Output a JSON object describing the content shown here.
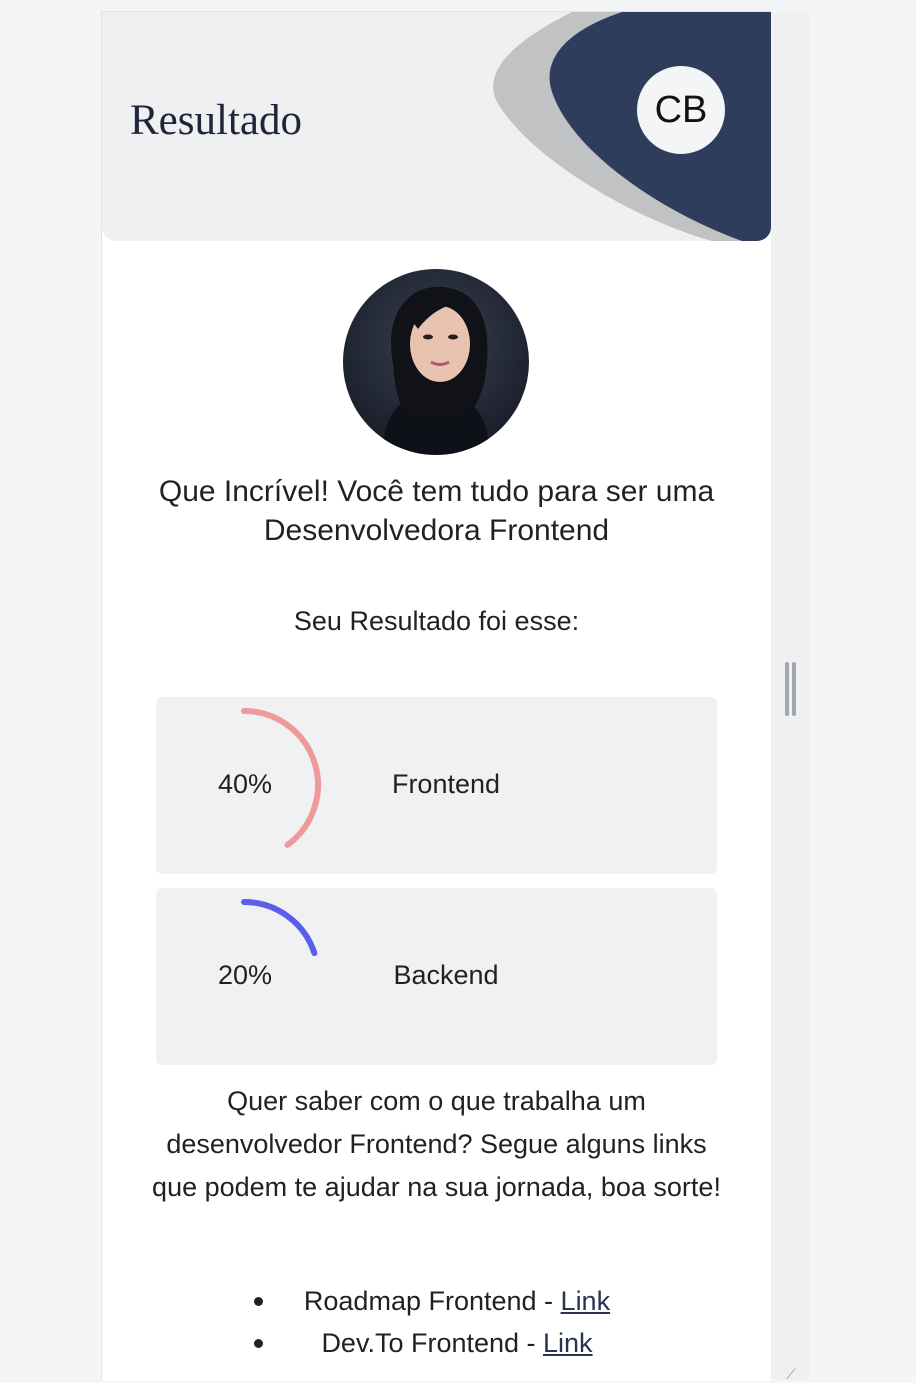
{
  "header": {
    "title": "Resultado",
    "badge_initials": "CB",
    "colors": {
      "background": "#eff0f2",
      "navy": "#2f3d5c",
      "gray_shape": "#c0c2c3"
    }
  },
  "result": {
    "headline": "Que Incrível! Você tem tudo para ser uma Desenvolvedora Frontend",
    "subtitle": "Seu Resultado foi esse:",
    "scores": [
      {
        "label": "Frontend",
        "percent_text": "40%",
        "value": 40,
        "color": "#ef9a9a"
      },
      {
        "label": "Backend",
        "percent_text": "20%",
        "value": 20,
        "color": "#5a5ee8"
      }
    ]
  },
  "info_text": "Quer saber com o que trabalha um desenvolvedor Frontend? Segue alguns links que podem te ajudar na sua jornada, boa sorte!",
  "links": [
    {
      "text": "Roadmap Frontend - ",
      "link_label": "Link"
    },
    {
      "text": "Dev.To Frontend - ",
      "link_label": "Link"
    }
  ]
}
